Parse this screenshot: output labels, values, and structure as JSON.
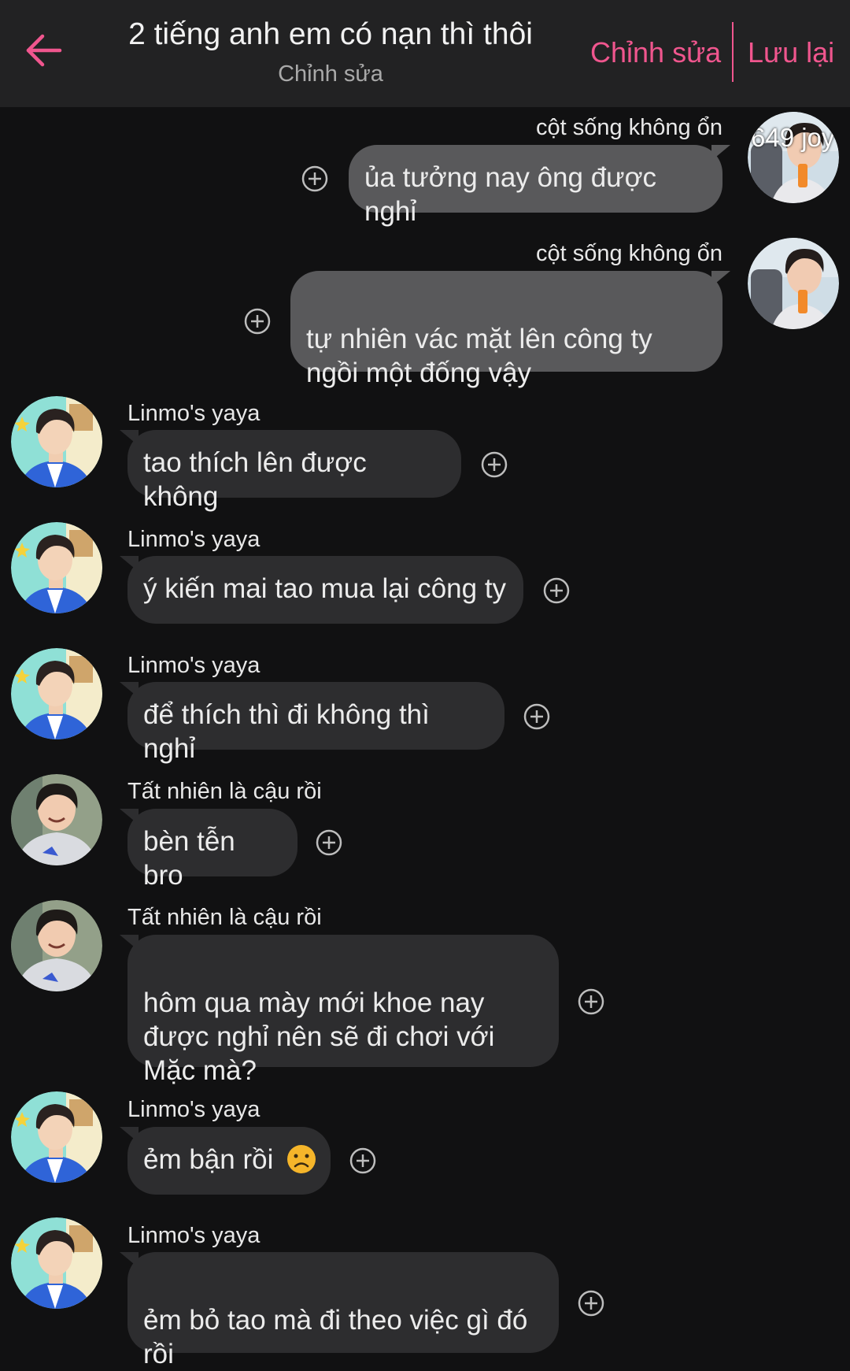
{
  "header": {
    "title": "2 tiếng anh em có nạn thì thôi",
    "subtitle": "Chỉnh sửa",
    "edit_label": "Chỉnh sửa",
    "save_label": "Lưu lại",
    "accent_color": "#f0568e"
  },
  "messages": [
    {
      "sender": "cột sống không ổn",
      "text": "ủa tưởng nay ông được nghỉ",
      "avatar_label": "649 joy",
      "direction": "out"
    },
    {
      "sender": "cột sống không ổn",
      "text": "tự nhiên vác mặt lên công ty\nngồi một đống vậy",
      "direction": "out"
    },
    {
      "sender": "Linmo's yaya",
      "text": "tao thích lên được không",
      "direction": "in"
    },
    {
      "sender": "Linmo's yaya",
      "text": "ý kiến mai tao mua lại công ty",
      "direction": "in"
    },
    {
      "sender": "Linmo's yaya",
      "text": "để thích thì đi không thì nghỉ",
      "direction": "in"
    },
    {
      "sender": "Tất nhiên là cậu rồi",
      "text": "bèn tễn bro",
      "direction": "in"
    },
    {
      "sender": "Tất nhiên là cậu rồi",
      "text": "hôm qua mày mới khoe nay\nđược nghỉ nên sẽ đi chơi với\nMặc mà?",
      "direction": "in"
    },
    {
      "sender": "Linmo's yaya",
      "text": "ẻm bận rồi",
      "emoji": "sad-face",
      "direction": "in"
    },
    {
      "sender": "Linmo's yaya",
      "text": "ẻm bỏ tao mà đi theo việc gì đó\nrồi",
      "direction": "in"
    }
  ]
}
